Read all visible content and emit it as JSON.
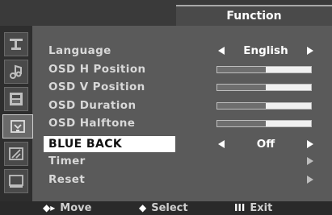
{
  "header": {
    "title": "Function"
  },
  "sidebar": {
    "icons": [
      {
        "name": "picture-icon",
        "active": false
      },
      {
        "name": "audio-icon",
        "active": false
      },
      {
        "name": "image-adjust-icon",
        "active": false
      },
      {
        "name": "function-icon",
        "active": true
      },
      {
        "name": "size-icon",
        "active": false
      },
      {
        "name": "input-icon",
        "active": false
      }
    ]
  },
  "menu": {
    "items": [
      {
        "label": "Language",
        "control": "select",
        "value": "English"
      },
      {
        "label": "OSD  H Position",
        "control": "slider",
        "level": 0.52
      },
      {
        "label": "OSD  V Position",
        "control": "slider",
        "level": 0.52
      },
      {
        "label": "OSD  Duration",
        "control": "slider",
        "level": 0.52
      },
      {
        "label": "OSD  Halftone",
        "control": "slider",
        "level": 0.52
      },
      {
        "label": "BLUE BACK",
        "control": "select",
        "value": "Off",
        "selected": true
      },
      {
        "label": "Timer",
        "control": "submenu"
      },
      {
        "label": "Reset",
        "control": "submenu"
      }
    ]
  },
  "footer": {
    "move": {
      "glyph": "◆▸",
      "label": "Move"
    },
    "select": {
      "glyph": "◆",
      "label": "Select"
    },
    "exit": {
      "glyph": "III",
      "label": "Exit"
    }
  },
  "colors": {
    "panel": "#5a5a5a",
    "selection": "#ffffff",
    "text": "#d8d8d8"
  }
}
